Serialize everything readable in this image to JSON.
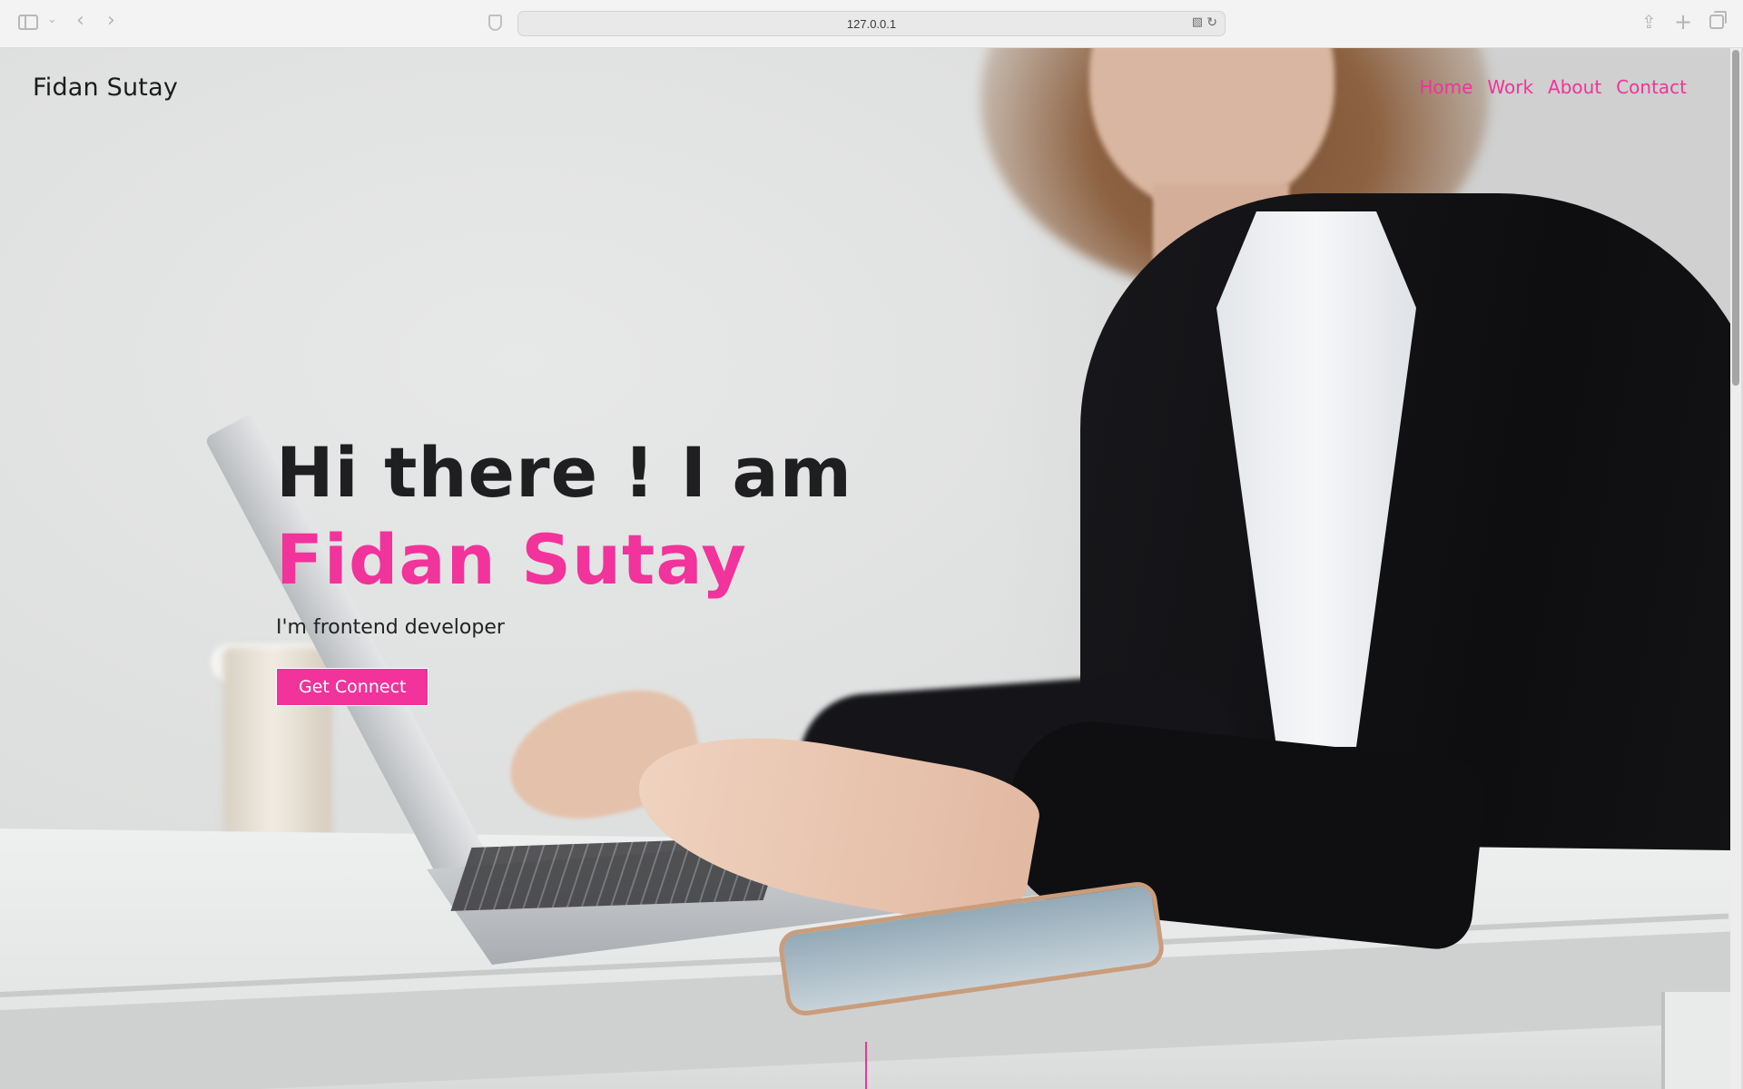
{
  "browser": {
    "url": "127.0.0.1"
  },
  "site": {
    "brand": "Fidan Sutay",
    "nav": {
      "home": "Home",
      "work": "Work",
      "about": "About",
      "contact": "Contact"
    },
    "accent_color": "#f1339b"
  },
  "hero": {
    "greeting": "Hi there ! I am",
    "name": "Fidan Sutay",
    "role": "I'm frontend developer",
    "cta_label": "Get Connect"
  },
  "icons": {
    "sidebar_toggle": "sidebar-icon",
    "back": "chevron-left-icon",
    "forward": "chevron-right-icon",
    "privacy": "shield-icon",
    "translate": "translate-icon",
    "reload": "reload-icon",
    "share": "share-icon",
    "new_tab": "plus-icon",
    "tab_overview": "tabs-icon"
  }
}
